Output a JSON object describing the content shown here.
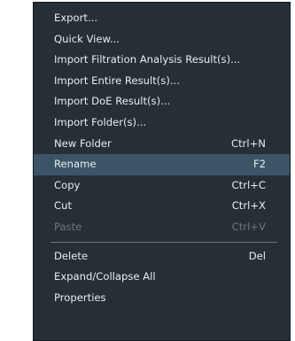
{
  "menu": {
    "items": [
      {
        "label": "Export...",
        "shortcut": ""
      },
      {
        "label": "Quick View...",
        "shortcut": ""
      },
      {
        "label": "Import Filtration Analysis Result(s)...",
        "shortcut": ""
      },
      {
        "label": "Import Entire Result(s)...",
        "shortcut": ""
      },
      {
        "label": "Import DoE Result(s)...",
        "shortcut": ""
      },
      {
        "label": "Import Folder(s)...",
        "shortcut": ""
      },
      {
        "label": "New Folder",
        "shortcut": "Ctrl+N"
      },
      {
        "label": "Rename",
        "shortcut": "F2",
        "state": "highlighted"
      },
      {
        "label": "Copy",
        "shortcut": "Ctrl+C"
      },
      {
        "label": "Cut",
        "shortcut": "Ctrl+X"
      },
      {
        "label": "Paste",
        "shortcut": "Ctrl+V",
        "state": "disabled"
      },
      {
        "label": "Delete",
        "shortcut": "Del"
      },
      {
        "label": "Expand/Collapse All",
        "shortcut": ""
      },
      {
        "label": "Properties",
        "shortcut": ""
      }
    ]
  },
  "colors": {
    "menu_background": "#262f36",
    "highlight_background": "#3b5567",
    "text": "#e8ecef",
    "disabled_text": "#6b767e",
    "separator": "#6b767e"
  }
}
